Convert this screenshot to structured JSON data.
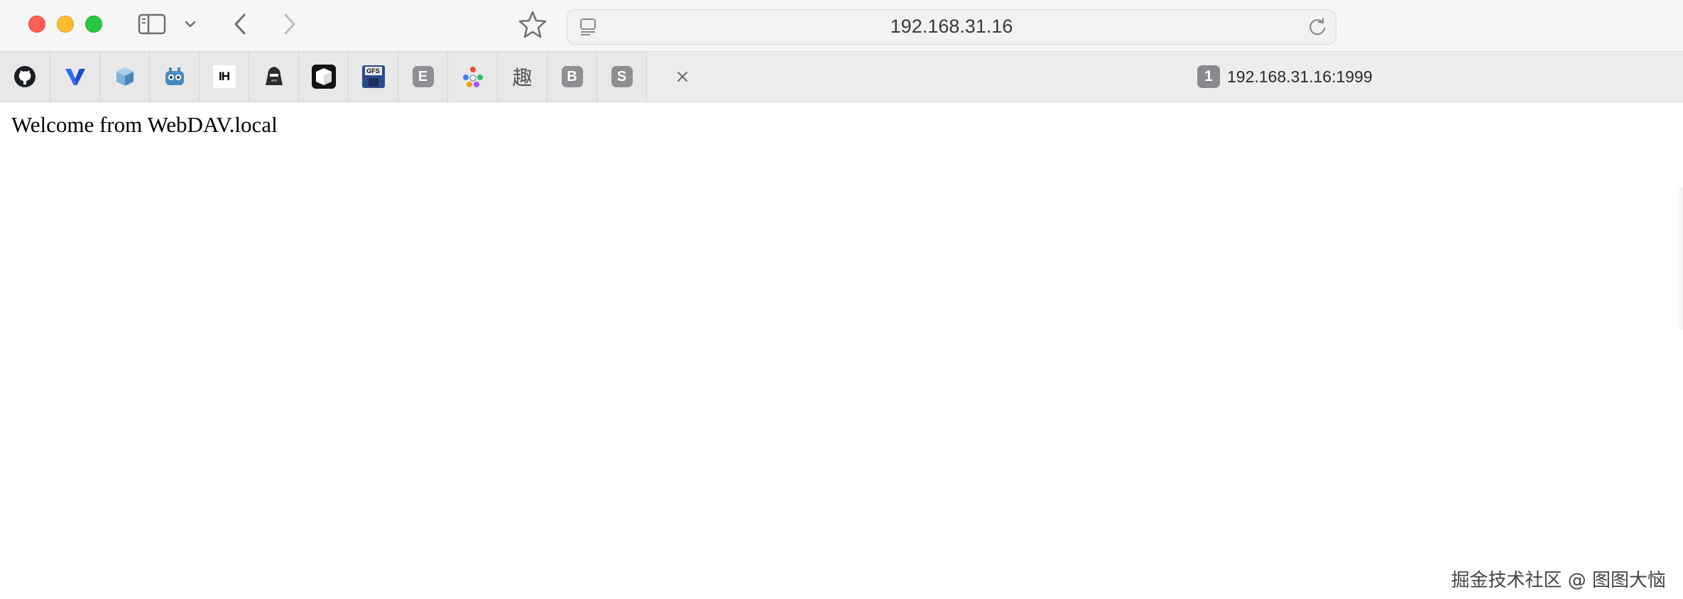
{
  "toolbar": {
    "address": "192.168.31.16"
  },
  "pinned_tabs": [
    {
      "icon": "github-icon"
    },
    {
      "icon": "vercel-v-icon"
    },
    {
      "icon": "cube-blue-icon"
    },
    {
      "icon": "godot-icon"
    },
    {
      "icon": "ih-icon",
      "text": "IH"
    },
    {
      "icon": "hacker-icon"
    },
    {
      "icon": "box-3d-icon"
    },
    {
      "icon": "gfs-floppy-icon",
      "text": "GFS"
    },
    {
      "icon": "letter-e-icon",
      "text": "E"
    },
    {
      "icon": "colorful-people-icon"
    },
    {
      "icon": "qu-char-icon",
      "text": "趣"
    },
    {
      "icon": "letter-b-icon",
      "text": "B"
    },
    {
      "icon": "letter-s-icon",
      "text": "S"
    }
  ],
  "active_tab": {
    "badge": "1",
    "title": "192.168.31.16:1999"
  },
  "page": {
    "welcome_text": "Welcome from WebDAV.local"
  },
  "watermark": "掘金技术社区 @ 图图大恼",
  "colors": {
    "close": "#fe5f57",
    "minimize": "#febc2e",
    "maximize": "#28c840"
  }
}
